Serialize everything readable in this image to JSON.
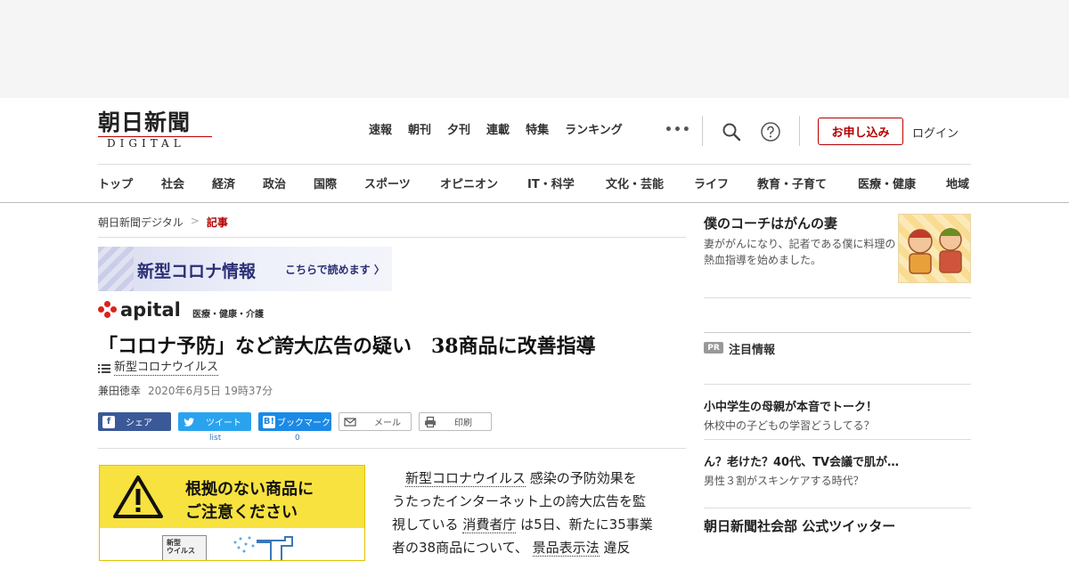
{
  "logo": {
    "main": "朝日新聞",
    "sub": "DIGITAL"
  },
  "topnav": [
    "速報",
    "朝刊",
    "夕刊",
    "連載",
    "特集",
    "ランキング"
  ],
  "header": {
    "subscribe": "お申し込み",
    "login": "ログイン",
    "more": "•••"
  },
  "catnav": [
    "トップ",
    "社会",
    "経済",
    "政治",
    "国際",
    "スポーツ",
    "オピニオン",
    "IT・科学",
    "文化・芸能",
    "ライフ",
    "教育・子育て",
    "医療・健康",
    "地域"
  ],
  "breadcrumb": {
    "home": "朝日新聞デジタル",
    "sep": ">",
    "current": "記事"
  },
  "corona_banner": {
    "title": "新型コロナ情報",
    "link": "こちらで読めます"
  },
  "apital": {
    "word": "apital",
    "category": "医療・健康・介護"
  },
  "article": {
    "headline": "「コロナ予防」など誇大広告の疑い　38商品に改善指導",
    "tag": "新型コロナウイルス",
    "author": "兼田徳幸",
    "datetime": "2020年6月5日 19時37分",
    "image_text1": "根拠のない商品に",
    "image_text2": "ご注意ください",
    "image_box": "新型\nウイルス",
    "body": {
      "p1a": "新型コロナウイルス",
      "p1b": "感染の予防効果を",
      "l2": "うたったインターネット上の誇大広告を監",
      "l3a": "視している",
      "l3b": "消費者庁",
      "l3c": "は5日、新たに35事業",
      "l4a": "者の38商品について、",
      "l4b": "景品表示法",
      "l4c": "違反"
    }
  },
  "share": {
    "facebook": "シェア",
    "twitter": "ツイート",
    "hatena": "ブックマーク",
    "mail": "メール",
    "print": "印刷",
    "tw_count": "list",
    "hb_count": "0"
  },
  "sidebar": {
    "feature_title": "僕のコーチはがんの妻",
    "feature_desc": "妻ががんになり、記者である僕に料理の熱血指導を始めました。",
    "pr_badge": "PR",
    "pr_title": "注目情報",
    "pr_items": [
      {
        "title": "小中学生の母親が本音でトーク！",
        "desc": "休校中の子どもの学習どうしてる？"
      },
      {
        "title": "ん？老けた？40代、TV会議で肌が…",
        "desc": "男性３割がスキンケアする時代？"
      }
    ],
    "twitter_title": "朝日新聞社会部 公式ツイッター"
  },
  "colors": {
    "accent": "#b40000",
    "facebook": "#3b5998",
    "twitter": "#2aa3ef",
    "hatena": "#1b8ae6",
    "corona_text": "#2b2f75",
    "image_yellow": "#f7e23f"
  }
}
